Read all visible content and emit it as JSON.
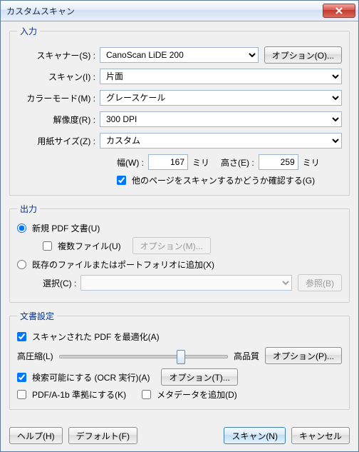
{
  "window": {
    "title": "カスタムスキャン"
  },
  "input": {
    "legend": "入力",
    "scanner_label": "スキャナー(S) :",
    "scanner_value": "CanoScan LiDE 200",
    "options_btn": "オプション(O)...",
    "sides_label": "スキャン(I) :",
    "sides_value": "片面",
    "color_label": "カラーモード(M) :",
    "color_value": "グレースケール",
    "res_label": "解像度(R) :",
    "res_value": "300 DPI",
    "paper_label": "用紙サイズ(Z) :",
    "paper_value": "カスタム",
    "width_label": "幅(W) :",
    "width_value": "167",
    "width_unit": "ミリ",
    "height_label": "高さ(E) :",
    "height_value": "259",
    "height_unit": "ミリ",
    "more_pages_label": "他のページをスキャンするかどうか確認する(G)",
    "more_pages_checked": true
  },
  "output": {
    "legend": "出力",
    "new_pdf_label": "新規 PDF 文書(U)",
    "multi_files_label": "複数ファイル(U)",
    "multi_options_btn": "オプション(M)...",
    "append_label": "既存のファイルまたはポートフォリオに追加(X)",
    "select_label": "選択(C) :",
    "browse_btn": "参照(B)"
  },
  "docset": {
    "legend": "文書設定",
    "optimize_label": "スキャンされた PDF を最適化(A)",
    "slider_left": "高圧縮(L)",
    "slider_right": "高品質",
    "slider_pos": 0.72,
    "opt_p_btn": "オプション(P)...",
    "ocr_label": "検索可能にする (OCR 実行)(A)",
    "opt_t_btn": "オプション(T)...",
    "pdfa_label": "PDF/A-1b 準拠にする(K)",
    "meta_label": "メタデータを追加(D)"
  },
  "buttons": {
    "help": "ヘルプ(H)",
    "defaults": "デフォルト(F)",
    "scan": "スキャン(N)",
    "cancel": "キャンセル"
  }
}
